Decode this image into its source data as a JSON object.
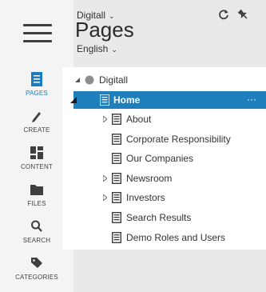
{
  "header": {
    "site_label": "Digitall",
    "title": "Pages",
    "language_label": "English"
  },
  "rail": {
    "items": [
      {
        "label": "PAGES",
        "icon": "pages-icon"
      },
      {
        "label": "CREATE",
        "icon": "pencil-icon"
      },
      {
        "label": "CONTENT",
        "icon": "content-grid-icon"
      },
      {
        "label": "FILES",
        "icon": "folder-icon"
      },
      {
        "label": "SEARCH",
        "icon": "search-icon"
      },
      {
        "label": "CATEGORIES",
        "icon": "tag-icon"
      }
    ]
  },
  "tree": {
    "root": "Digitall",
    "selected": "Home",
    "selected_menu": "···",
    "children": [
      "About",
      "Corporate Responsibility",
      "Our Companies",
      "Newsroom",
      "Investors",
      "Search Results",
      "Demo Roles and Users"
    ]
  },
  "colors": {
    "accent": "#1f7fbd",
    "rail_bg": "#f4f4f4",
    "page_bg": "#e9e9e9"
  }
}
